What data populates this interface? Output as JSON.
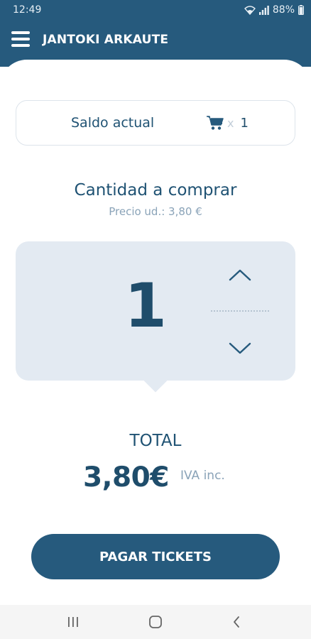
{
  "status_bar": {
    "time": "12:49",
    "battery": "88%"
  },
  "app_bar": {
    "title": "JANTOKI ARKAUTE"
  },
  "balance": {
    "label": "Saldo actual",
    "multiplier": "x",
    "count": "1"
  },
  "quantity_section": {
    "title": "Cantidad a comprar",
    "unit_price": "Precio ud.: 3,80 €",
    "quantity": "1"
  },
  "total": {
    "label": "TOTAL",
    "amount": "3,80€",
    "vat_note": "IVA inc."
  },
  "pay_button": {
    "label": "PAGAR TICKETS"
  },
  "colors": {
    "primary": "#265a7d",
    "text_dark": "#1f4d6b",
    "panel": "#e3eaf2",
    "muted": "#8aa3b8"
  },
  "icons": [
    "menu-icon",
    "cart-icon",
    "chevron-up-icon",
    "chevron-down-icon",
    "wifi-icon",
    "signal-icon",
    "battery-icon",
    "recents-icon",
    "home-icon",
    "back-icon"
  ]
}
